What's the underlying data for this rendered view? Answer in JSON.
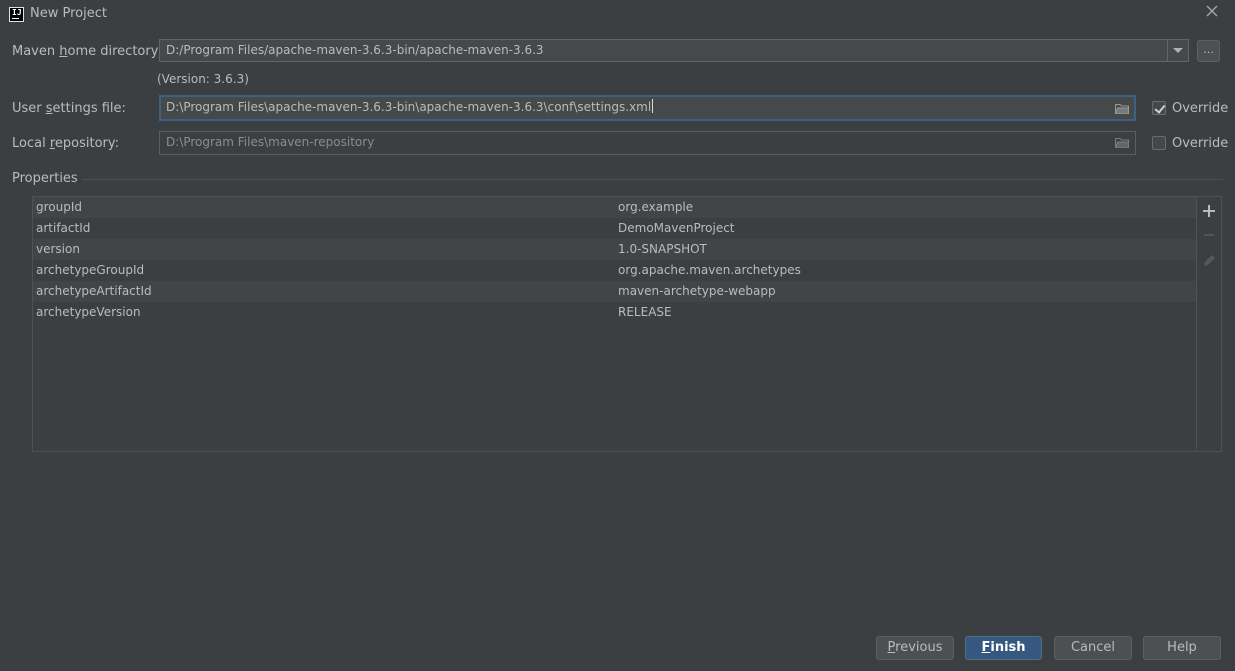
{
  "window": {
    "title": "New Project",
    "app_icon": "IJ"
  },
  "maven_home": {
    "label_pre": "Maven ",
    "label_mnemonic": "h",
    "label_post": "ome directory:",
    "value": "D:/Program Files/apache-maven-3.6.3-bin/apache-maven-3.6.3",
    "dots_label": "...",
    "version_note": "(Version: 3.6.3)"
  },
  "user_settings": {
    "label_pre": "User ",
    "label_mnemonic": "s",
    "label_post": "ettings file:",
    "value": "D:\\Program Files\\apache-maven-3.6.3-bin\\apache-maven-3.6.3\\conf\\settings.xml",
    "override_label": "Override",
    "override_checked": true
  },
  "local_repo": {
    "label_pre": "Local ",
    "label_mnemonic": "r",
    "label_post": "epository:",
    "value": "D:\\Program Files\\maven-repository",
    "override_label": "Override",
    "override_checked": false
  },
  "properties": {
    "title": "Properties",
    "rows": [
      {
        "key": "groupId",
        "value": "org.example"
      },
      {
        "key": "artifactId",
        "value": "DemoMavenProject"
      },
      {
        "key": "version",
        "value": "1.0-SNAPSHOT"
      },
      {
        "key": "archetypeGroupId",
        "value": "org.apache.maven.archetypes"
      },
      {
        "key": "archetypeArtifactId",
        "value": "maven-archetype-webapp"
      },
      {
        "key": "archetypeVersion",
        "value": "RELEASE"
      }
    ],
    "toolbar": {
      "add_icon": "plus-icon",
      "remove_icon": "minus-icon",
      "edit_icon": "pencil-icon"
    }
  },
  "buttons": {
    "previous_pre": "",
    "previous_mnemonic": "P",
    "previous_post": "revious",
    "finish_pre": "",
    "finish_mnemonic": "F",
    "finish_post": "inish",
    "cancel": "Cancel",
    "help": "Help"
  },
  "colors": {
    "background": "#3c3f41",
    "field_background": "#45494a",
    "focus_border": "#3d6185",
    "default_button": "#365880",
    "text": "#bbbbbb"
  }
}
